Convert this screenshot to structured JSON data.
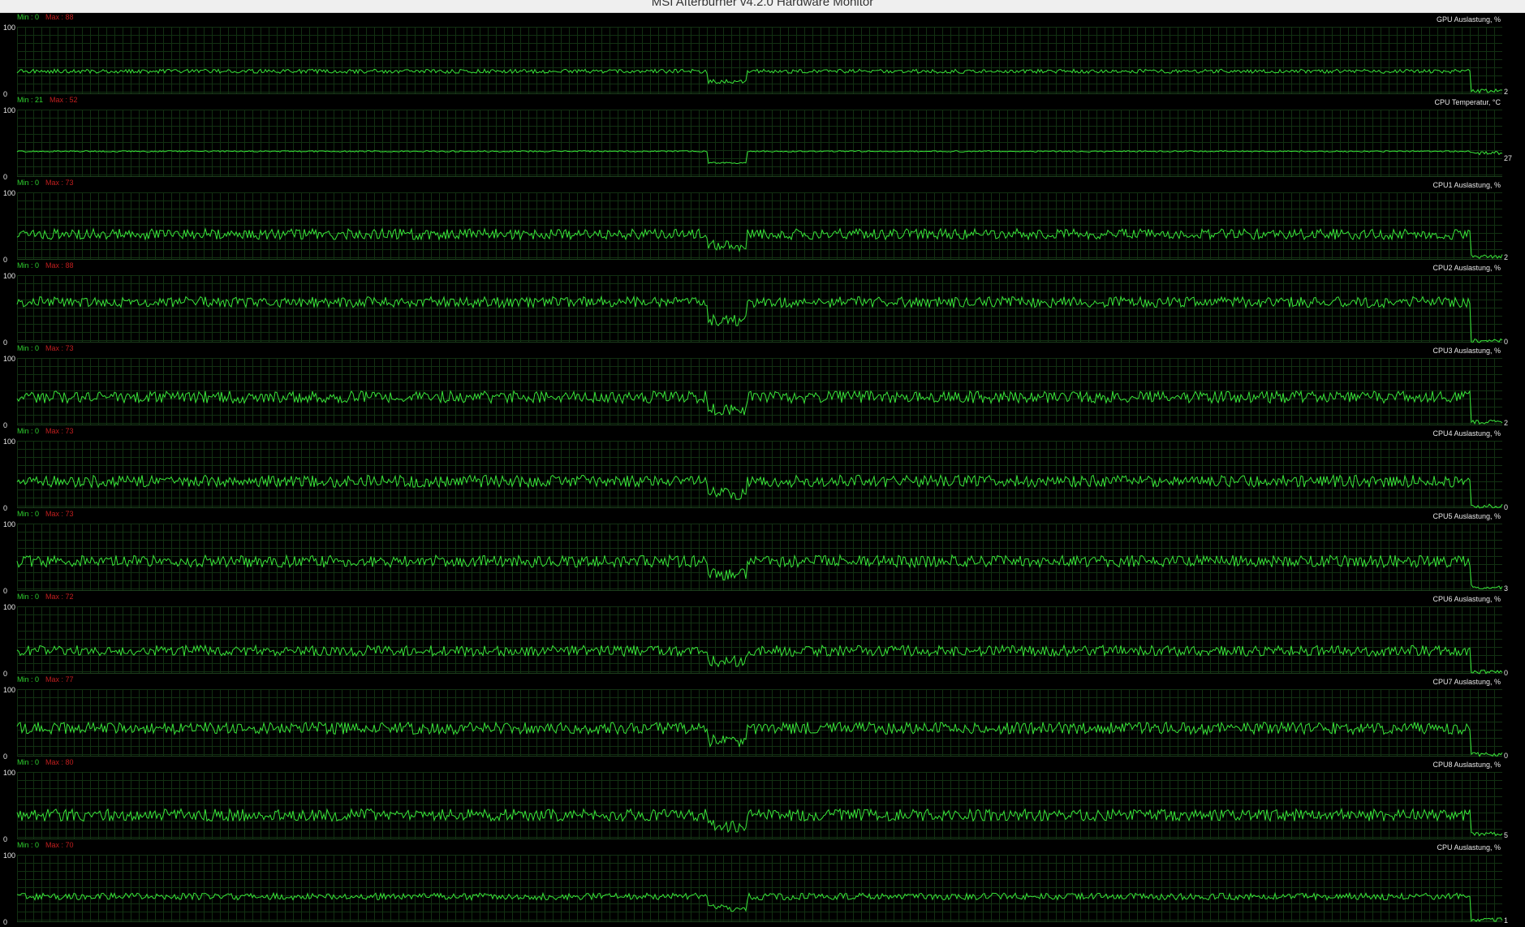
{
  "window": {
    "title": "MSI Afterburner v4.2.0 Hardware Monitor"
  },
  "colors": {
    "background": "#000000",
    "grid": "#123012",
    "line": "#39e639",
    "min_label": "#2fd12f",
    "max_label": "#c21f1f",
    "text": "#e6e6e6"
  },
  "y_axis": {
    "top": "100",
    "bottom": "0"
  },
  "graphs": [
    {
      "name": "GPU Auslastung, %",
      "min": "Min : 0",
      "max": "Max : 88",
      "current": "2",
      "current_value": 2,
      "baseline": 34,
      "amplitude": 3,
      "end_dip": true
    },
    {
      "name": "CPU Temperatur, °C",
      "min": "Min : 21",
      "max": "Max : 52",
      "current": "27",
      "current_value": 27,
      "baseline": 38,
      "amplitude": 1,
      "end_dip": false
    },
    {
      "name": "CPU1 Auslastung, %",
      "min": "Min : 0",
      "max": "Max : 73",
      "current": "2",
      "current_value": 2,
      "baseline": 38,
      "amplitude": 8,
      "end_dip": true
    },
    {
      "name": "CPU2 Auslastung, %",
      "min": "Min : 0",
      "max": "Max : 88",
      "current": "0",
      "current_value": 0,
      "baseline": 60,
      "amplitude": 8,
      "end_dip": true
    },
    {
      "name": "CPU3 Auslastung, %",
      "min": "Min : 0",
      "max": "Max : 73",
      "current": "2",
      "current_value": 2,
      "baseline": 42,
      "amplitude": 9,
      "end_dip": true
    },
    {
      "name": "CPU4 Auslastung, %",
      "min": "Min : 0",
      "max": "Max : 73",
      "current": "0",
      "current_value": 0,
      "baseline": 40,
      "amplitude": 9,
      "end_dip": true
    },
    {
      "name": "CPU5 Auslastung, %",
      "min": "Min : 0",
      "max": "Max : 73",
      "current": "3",
      "current_value": 3,
      "baseline": 44,
      "amplitude": 9,
      "end_dip": true
    },
    {
      "name": "CPU6 Auslastung, %",
      "min": "Min : 0",
      "max": "Max : 72",
      "current": "0",
      "current_value": 0,
      "baseline": 34,
      "amplitude": 8,
      "end_dip": true
    },
    {
      "name": "CPU7 Auslastung, %",
      "min": "Min : 0",
      "max": "Max : 77",
      "current": "0",
      "current_value": 0,
      "baseline": 42,
      "amplitude": 9,
      "end_dip": true
    },
    {
      "name": "CPU8 Auslastung, %",
      "min": "Min : 0",
      "max": "Max : 80",
      "current": "5",
      "current_value": 5,
      "baseline": 36,
      "amplitude": 9,
      "end_dip": true
    },
    {
      "name": "CPU Auslastung, %",
      "min": "Min : 0",
      "max": "Max : 70",
      "current": "1",
      "current_value": 1,
      "baseline": 38,
      "amplitude": 5,
      "end_dip": true
    }
  ]
}
